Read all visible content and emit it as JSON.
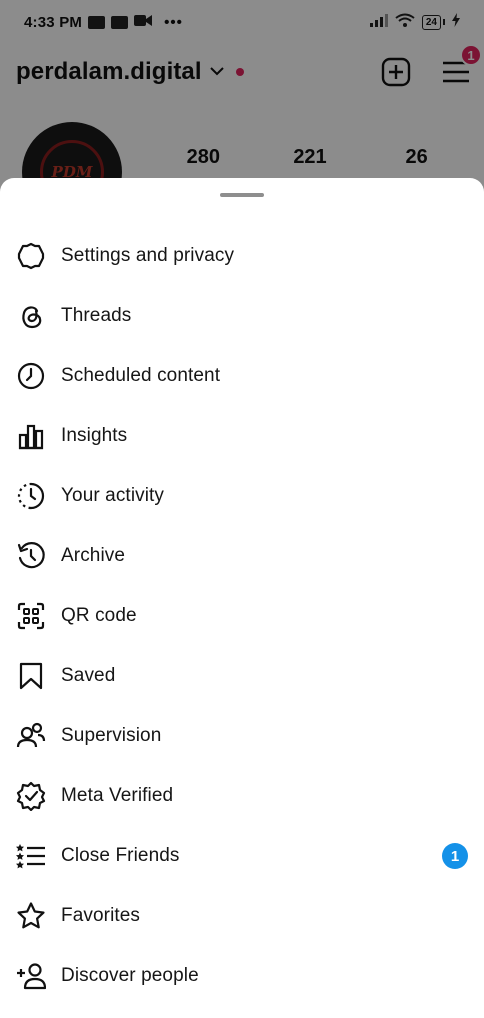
{
  "status_bar": {
    "time": "4:33 PM",
    "dots": "•••",
    "battery": "24"
  },
  "header": {
    "username": "perdalam.digital",
    "menu_badge": "1"
  },
  "profile": {
    "avatar_text": "PDM",
    "stats": [
      "280",
      "221",
      "26"
    ]
  },
  "sheet": {
    "items": [
      {
        "label": "Settings and privacy",
        "icon": "settings-icon"
      },
      {
        "label": "Threads",
        "icon": "threads-icon"
      },
      {
        "label": "Scheduled content",
        "icon": "clock-icon"
      },
      {
        "label": "Insights",
        "icon": "bar-chart-icon"
      },
      {
        "label": "Your activity",
        "icon": "activity-icon"
      },
      {
        "label": "Archive",
        "icon": "archive-icon"
      },
      {
        "label": "QR code",
        "icon": "qr-code-icon"
      },
      {
        "label": "Saved",
        "icon": "bookmark-icon"
      },
      {
        "label": "Supervision",
        "icon": "supervision-icon"
      },
      {
        "label": "Meta Verified",
        "icon": "verified-badge-icon"
      },
      {
        "label": "Close Friends",
        "icon": "close-friends-list-icon",
        "badge": "1"
      },
      {
        "label": "Favorites",
        "icon": "star-icon"
      },
      {
        "label": "Discover people",
        "icon": "add-person-icon"
      }
    ]
  },
  "colors": {
    "notification_red": "#e0245e",
    "badge_blue": "#1491e8",
    "scrim": "rgba(0,0,0,0.45)"
  }
}
